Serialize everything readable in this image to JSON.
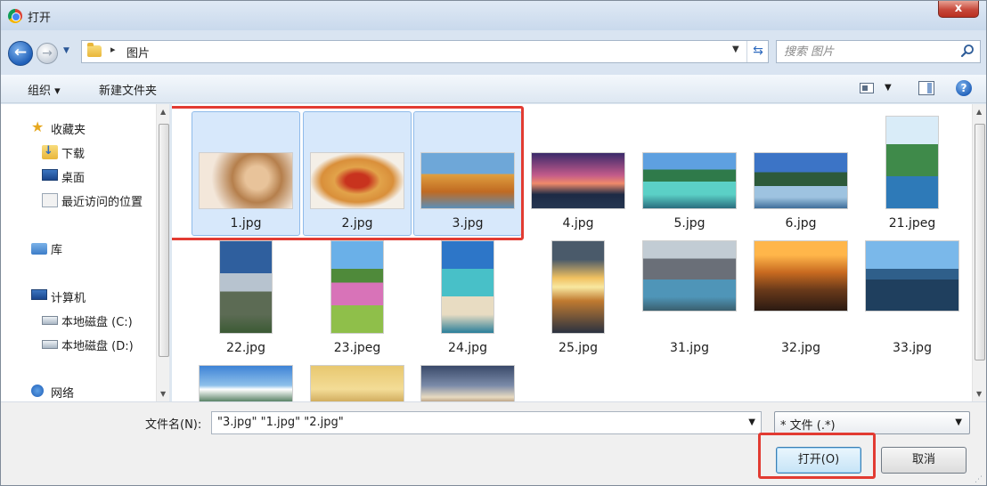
{
  "window": {
    "title": "打开",
    "close_glyph": "x"
  },
  "address": {
    "breadcrumb": "图片",
    "search_placeholder": "搜索 图片"
  },
  "toolbar": {
    "organize": "组织 ▾",
    "new_folder": "新建文件夹",
    "help_glyph": "?"
  },
  "nav": {
    "favorites": "收藏夹",
    "downloads": "下载",
    "desktop": "桌面",
    "recent": "最近访问的位置",
    "libraries": "库",
    "computer": "计算机",
    "drive_c": "本地磁盘 (C:)",
    "drive_d": "本地磁盘 (D:)",
    "network": "网络"
  },
  "files": [
    {
      "name": "1.jpg",
      "selected": true
    },
    {
      "name": "2.jpg",
      "selected": true
    },
    {
      "name": "3.jpg",
      "selected": true
    },
    {
      "name": "4.jpg",
      "selected": false
    },
    {
      "name": "5.jpg",
      "selected": false
    },
    {
      "name": "6.jpg",
      "selected": false
    },
    {
      "name": "21.jpeg",
      "selected": false
    },
    {
      "name": "22.jpg",
      "selected": false
    },
    {
      "name": "23.jpeg",
      "selected": false
    },
    {
      "name": "24.jpg",
      "selected": false
    },
    {
      "name": "25.jpg",
      "selected": false
    },
    {
      "name": "31.jpg",
      "selected": false
    },
    {
      "name": "32.jpg",
      "selected": false
    },
    {
      "name": "33.jpg",
      "selected": false
    }
  ],
  "footer": {
    "filename_label": "文件名(N):",
    "filename_value": "\"3.jpg\" \"1.jpg\" \"2.jpg\"",
    "filetype_value": "* 文件 (.*)",
    "open_button": "打开(O)",
    "cancel_button": "取消"
  },
  "colors": {
    "highlight": "#e23b32",
    "selection": "#d7e8fb",
    "accent": "#1f5fb8"
  }
}
